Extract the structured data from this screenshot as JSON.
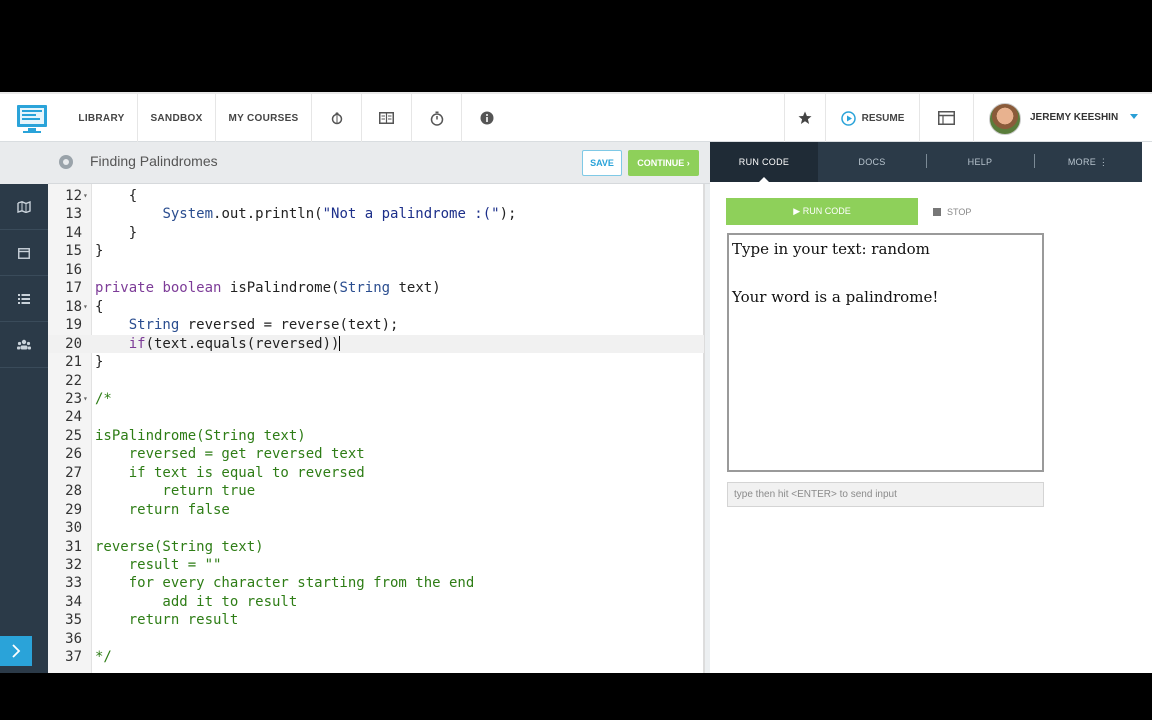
{
  "nav": {
    "library": "LIBRARY",
    "sandbox": "SANDBOX",
    "my_courses": "MY COURSES",
    "resume": "RESUME",
    "user_name": "JEREMY KEESHIN"
  },
  "editor": {
    "title": "Finding Palindromes",
    "save_label": "SAVE",
    "continue_label": "CONTINUE ›",
    "lines": [
      {
        "n": "12",
        "fold": true,
        "code": "    {"
      },
      {
        "n": "13",
        "fold": false,
        "code": "        System.out.println(\"Not a palindrome :(\");"
      },
      {
        "n": "14",
        "fold": false,
        "code": "    }"
      },
      {
        "n": "15",
        "fold": false,
        "code": "}"
      },
      {
        "n": "16",
        "fold": false,
        "code": ""
      },
      {
        "n": "17",
        "fold": false,
        "code": "private boolean isPalindrome(String text)"
      },
      {
        "n": "18",
        "fold": true,
        "code": "{"
      },
      {
        "n": "19",
        "fold": false,
        "code": "    String reversed = reverse(text);"
      },
      {
        "n": "20",
        "fold": false,
        "code": "    if(text.equals(reversed))"
      },
      {
        "n": "21",
        "fold": false,
        "code": "}"
      },
      {
        "n": "22",
        "fold": false,
        "code": ""
      },
      {
        "n": "23",
        "fold": true,
        "code": "/*"
      },
      {
        "n": "24",
        "fold": false,
        "code": ""
      },
      {
        "n": "25",
        "fold": false,
        "code": "isPalindrome(String text)"
      },
      {
        "n": "26",
        "fold": false,
        "code": "    reversed = get reversed text"
      },
      {
        "n": "27",
        "fold": false,
        "code": "    if text is equal to reversed"
      },
      {
        "n": "28",
        "fold": false,
        "code": "        return true"
      },
      {
        "n": "29",
        "fold": false,
        "code": "    return false"
      },
      {
        "n": "30",
        "fold": false,
        "code": ""
      },
      {
        "n": "31",
        "fold": false,
        "code": "reverse(String text)"
      },
      {
        "n": "32",
        "fold": false,
        "code": "    result = \"\""
      },
      {
        "n": "33",
        "fold": false,
        "code": "    for every character starting from the end"
      },
      {
        "n": "34",
        "fold": false,
        "code": "        add it to result"
      },
      {
        "n": "35",
        "fold": false,
        "code": "    return result"
      },
      {
        "n": "36",
        "fold": false,
        "code": ""
      },
      {
        "n": "37",
        "fold": false,
        "code": "*/"
      }
    ],
    "active_line": "20"
  },
  "panel": {
    "tabs": [
      "RUN CODE",
      "DOCS",
      "HELP",
      "MORE ⋮"
    ],
    "run_label": "▶  RUN CODE",
    "stop_label": "STOP",
    "console_lines": [
      "Type in your text: random",
      "",
      "Your word is a palindrome!"
    ],
    "input_placeholder": "type then hit <ENTER> to send input"
  },
  "colors": {
    "accent_green": "#8ed05a",
    "accent_blue": "#2aa3d9",
    "sidebar_dark": "#2b3a48"
  },
  "icons": [
    "logo-icon",
    "bug-icon",
    "book-icon",
    "stopwatch-icon",
    "info-icon",
    "star-icon",
    "play-circle-icon",
    "window-icon",
    "map-icon",
    "calendar-icon",
    "list-icon",
    "group-icon",
    "chevron-right-icon",
    "gear-icon",
    "stop-icon"
  ]
}
